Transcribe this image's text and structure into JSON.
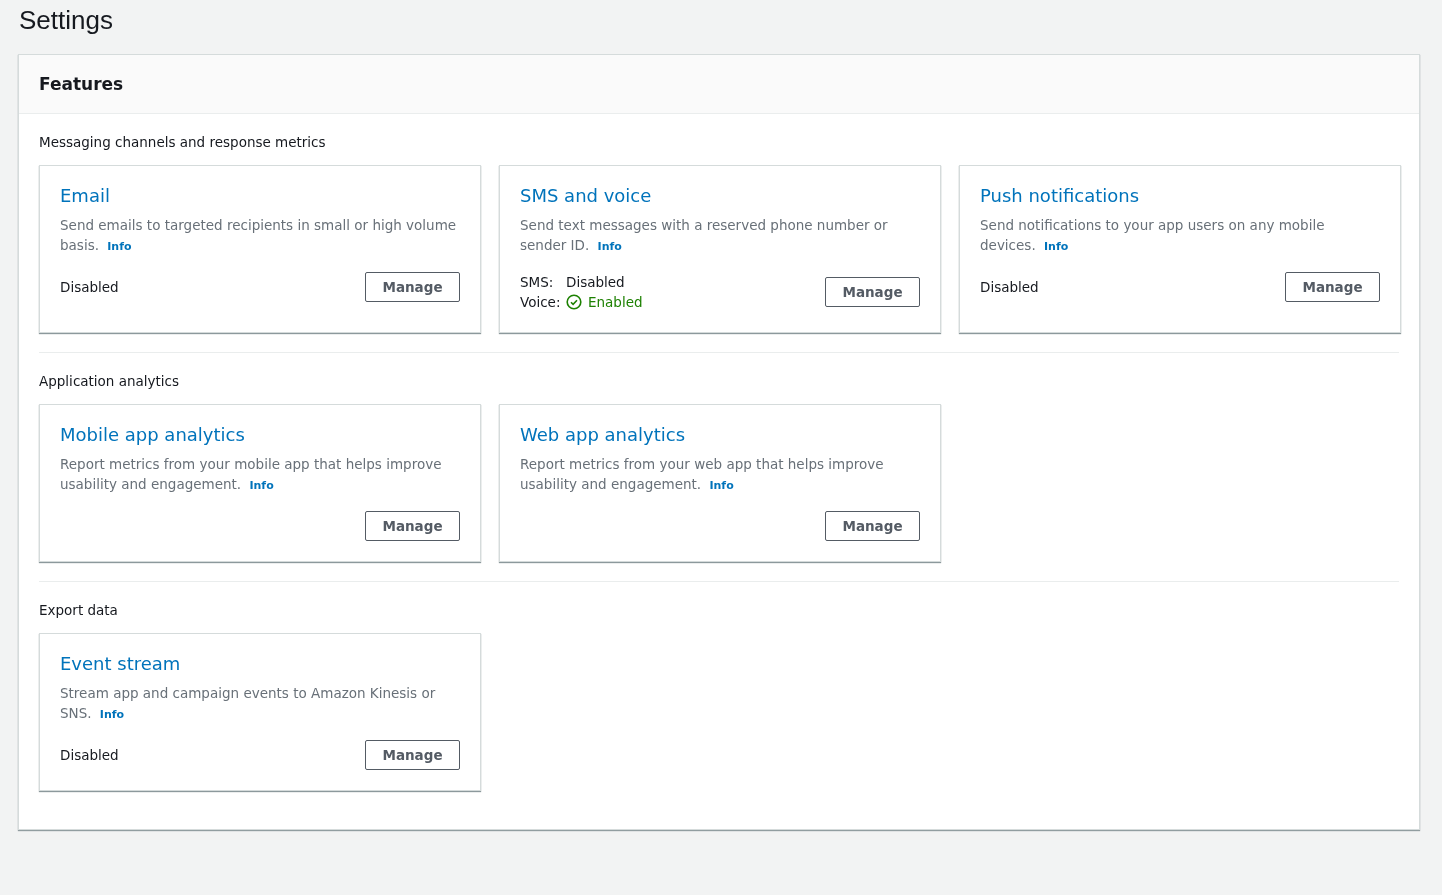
{
  "page_title": "Settings",
  "panel": {
    "title": "Features",
    "sections": [
      {
        "title": "Messaging channels and response metrics",
        "cards": [
          {
            "title": "Email",
            "description": "Send emails to targeted recipients in small or high volume basis.",
            "info": "Info",
            "statuses": [
              {
                "value": "Disabled",
                "enabled": false
              }
            ],
            "button": "Manage"
          },
          {
            "title": "SMS and voice",
            "description": "Send text messages with a reserved phone number or sender ID.",
            "info": "Info",
            "statuses": [
              {
                "label": "SMS:",
                "value": "Disabled",
                "enabled": false
              },
              {
                "label": "Voice:",
                "value": "Enabled",
                "enabled": true
              }
            ],
            "button": "Manage"
          },
          {
            "title": "Push notifications",
            "description": "Send notifications to your app users on any mobile devices.",
            "info": "Info",
            "statuses": [
              {
                "value": "Disabled",
                "enabled": false
              }
            ],
            "button": "Manage"
          }
        ]
      },
      {
        "title": "Application analytics",
        "cards": [
          {
            "title": "Mobile app analytics",
            "description": "Report metrics from your mobile app that helps improve usability and engagement.",
            "info": "Info",
            "button": "Manage"
          },
          {
            "title": "Web app analytics",
            "description": "Report metrics from your web app that helps improve usability and engagement.",
            "info": "Info",
            "button": "Manage"
          }
        ]
      },
      {
        "title": "Export data",
        "cards": [
          {
            "title": "Event stream",
            "description": "Stream app and campaign events to Amazon Kinesis or SNS.",
            "info": "Info",
            "statuses": [
              {
                "value": "Disabled",
                "enabled": false
              }
            ],
            "button": "Manage"
          }
        ]
      }
    ]
  }
}
